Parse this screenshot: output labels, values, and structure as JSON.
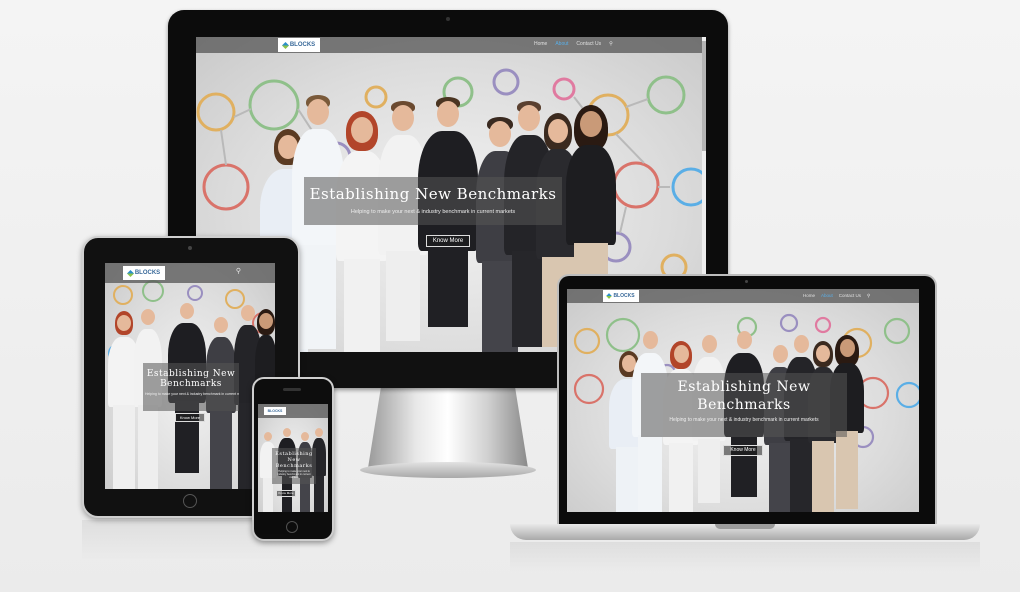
{
  "site": {
    "logo_text": "BLOCKS",
    "nav": {
      "home": "Home",
      "about": "About",
      "contact": "Contact Us"
    },
    "hero_title": "Establishing New Benchmarks",
    "hero_title_line1": "Establishing New",
    "hero_title_line2": "Benchmarks",
    "hero_subtitle": "Helping to make your next & industry benchmark in current markets",
    "tablet_title_line1": "Establishing New",
    "tablet_title_line2": "Benchmarks",
    "phone_title": "Establishing New Benchmarks",
    "cta": "Know More"
  },
  "colors": {
    "accent": "#5aaee6",
    "header_bg": "#5a5a5a",
    "hero_overlay": "#555555",
    "frame": "#0c0c0c"
  },
  "icons": {
    "search": "search-icon",
    "logo": "logo-mark-icon"
  }
}
